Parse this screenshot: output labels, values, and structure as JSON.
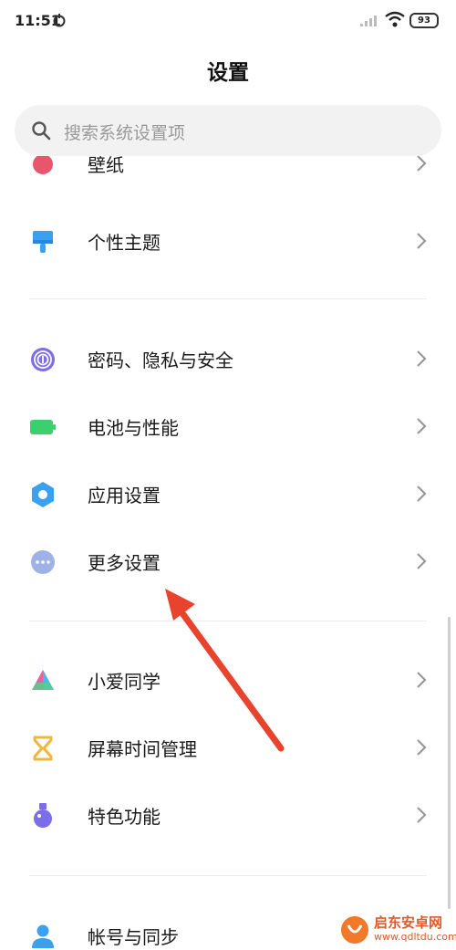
{
  "status": {
    "time": "11:51",
    "battery": "93"
  },
  "title": "设置",
  "search": {
    "placeholder": "搜索系统设置项"
  },
  "rows": [
    {
      "label": "壁纸",
      "icon": "wallpaper-icon"
    },
    {
      "label": "个性主题",
      "icon": "theme-brush-icon"
    },
    {
      "label": "密码、隐私与安全",
      "icon": "fingerprint-icon"
    },
    {
      "label": "电池与性能",
      "icon": "battery-icon"
    },
    {
      "label": "应用设置",
      "icon": "app-settings-gear-icon"
    },
    {
      "label": "更多设置",
      "icon": "more-dots-icon"
    },
    {
      "label": "小爱同学",
      "icon": "xiaoai-icon"
    },
    {
      "label": "屏幕时间管理",
      "icon": "hourglass-icon"
    },
    {
      "label": "特色功能",
      "icon": "flask-icon"
    },
    {
      "label": "帐号与同步",
      "icon": "account-icon"
    }
  ],
  "watermark": {
    "text": "启东安卓网",
    "url": "www.qdltdu.com"
  },
  "colors": {
    "accent_red": "#e8432c",
    "blue": "#3aa0f0",
    "green": "#3ccf6e"
  }
}
